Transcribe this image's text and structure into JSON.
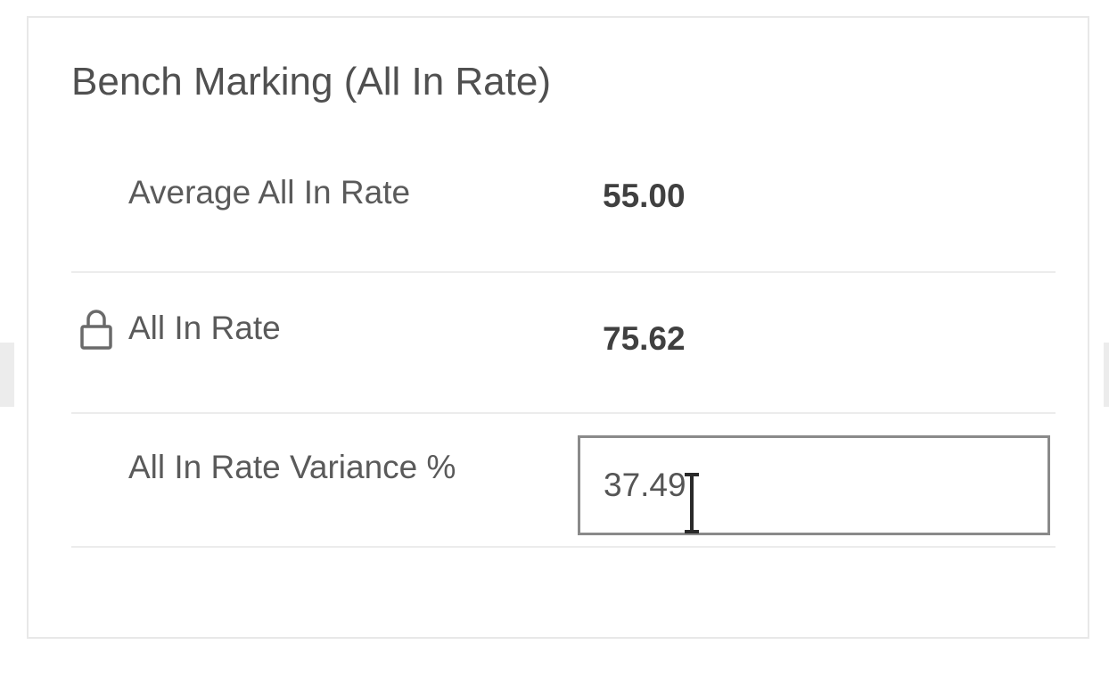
{
  "panel": {
    "title": "Bench Marking (All In Rate)"
  },
  "rows": [
    {
      "label": "Average All In Rate",
      "value": "55.00"
    },
    {
      "label": "All In Rate",
      "value": "75.62",
      "icon": "lock-icon"
    },
    {
      "label": "All In Rate Variance %",
      "input_value": "37.49"
    }
  ]
}
